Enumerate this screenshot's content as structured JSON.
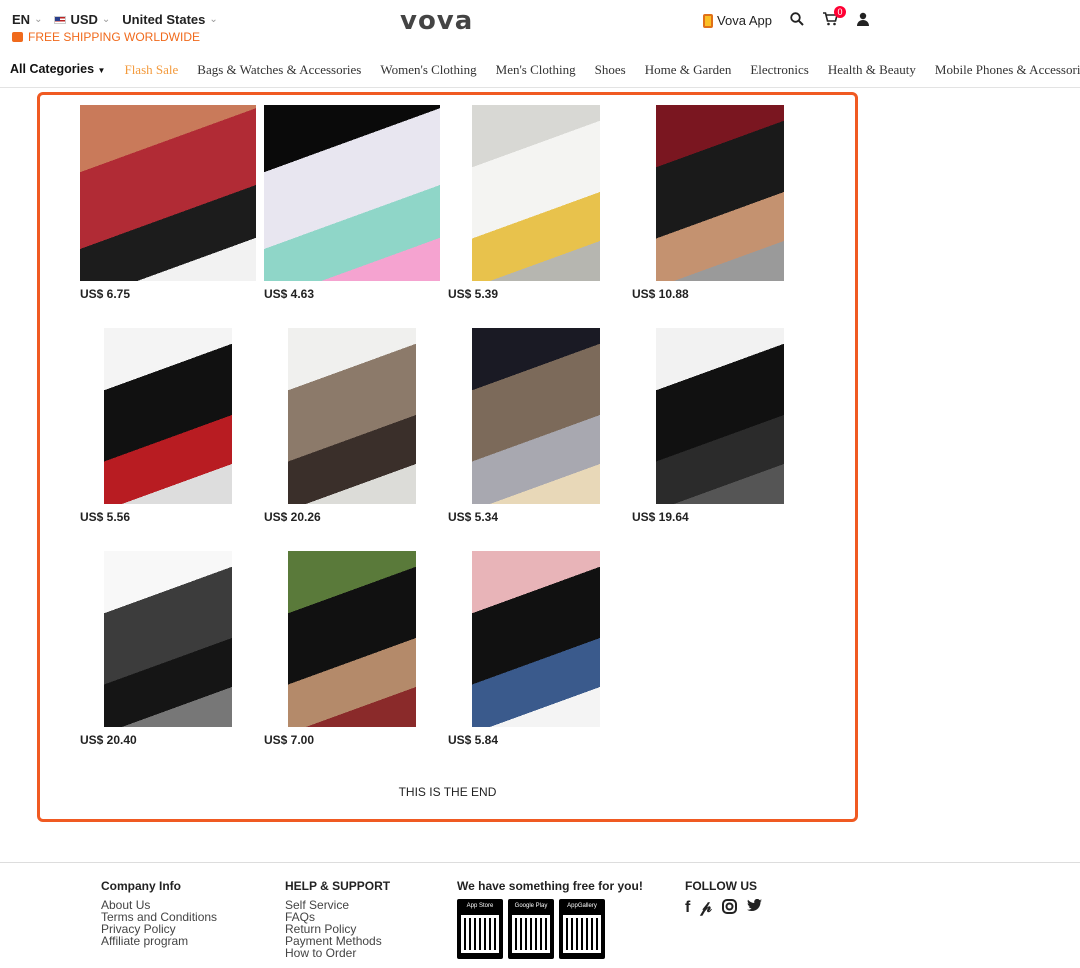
{
  "header": {
    "language": "EN",
    "currency": "USD",
    "country": "United States",
    "shipping_note": "FREE SHIPPING WORLDWIDE",
    "logo": "vova",
    "app_label": "Vova App",
    "cart_count": "0"
  },
  "nav": {
    "items": [
      "All Categories",
      "Flash Sale",
      "Bags & Watches & Accessories",
      "Women's Clothing",
      "Men's Clothing",
      "Shoes",
      "Home & Garden",
      "Electronics",
      "Health & Beauty",
      "Mobile Phones & Accessories"
    ]
  },
  "products": [
    {
      "price": "US$ 6.75",
      "colors": [
        "#c97a5a",
        "#b12b35",
        "#1c1c1c",
        "#f2f2f2"
      ]
    },
    {
      "price": "US$ 4.63",
      "colors": [
        "#0a0a0a",
        "#e8e6f0",
        "#8fd6c8",
        "#f5a3d0"
      ]
    },
    {
      "price": "US$ 5.39",
      "colors": [
        "#d8d8d4",
        "#f4f4f2",
        "#e8c24c",
        "#b6b6b0"
      ]
    },
    {
      "price": "US$ 10.88",
      "colors": [
        "#7a1620",
        "#1a1a1a",
        "#c49270",
        "#9a9a9a"
      ]
    },
    {
      "price": "US$ 5.56",
      "colors": [
        "#f4f4f4",
        "#111111",
        "#b81c22",
        "#ddd"
      ]
    },
    {
      "price": "US$ 20.26",
      "colors": [
        "#f0f0ee",
        "#8c7a6a",
        "#3a2f2a",
        "#dcdcd8"
      ]
    },
    {
      "price": "US$ 5.34",
      "colors": [
        "#1a1a24",
        "#7c6a5a",
        "#a8a8b0",
        "#e8d8b8"
      ]
    },
    {
      "price": "US$ 19.64",
      "colors": [
        "#f2f2f2",
        "#111111",
        "#2b2b2b",
        "#555"
      ]
    },
    {
      "price": "US$ 20.40",
      "colors": [
        "#f8f8f8",
        "#3c3c3c",
        "#151515",
        "#777"
      ]
    },
    {
      "price": "US$ 7.00",
      "colors": [
        "#5a7a3a",
        "#111111",
        "#b48a6a",
        "#8a2a2a"
      ]
    },
    {
      "price": "US$ 5.84",
      "colors": [
        "#e8b4b8",
        "#111111",
        "#3a5a8c",
        "#f4f4f4"
      ]
    }
  ],
  "end_text": "THIS IS THE END",
  "footer": {
    "company": {
      "title": "Company Info",
      "links": [
        "About Us",
        "Terms and Conditions",
        "Privacy Policy",
        "Affiliate program"
      ]
    },
    "help": {
      "title": "HELP & SUPPORT",
      "links": [
        "Self Service",
        "FAQs",
        "Return Policy",
        "Payment Methods",
        "How to Order"
      ]
    },
    "app": {
      "title": "We have something free for you!",
      "stores": [
        "App Store",
        "Google Play",
        "AppGallery"
      ]
    },
    "follow": {
      "title": "FOLLOW US",
      "icons": [
        "facebook-icon",
        "pinterest-icon",
        "instagram-icon",
        "twitter-icon"
      ]
    }
  }
}
